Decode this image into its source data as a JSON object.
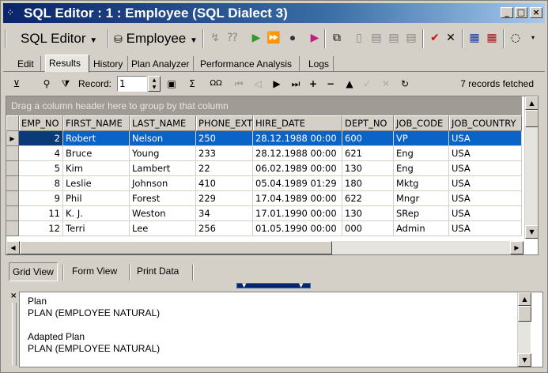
{
  "window": {
    "title": "SQL Editor : 1 : Employee (SQL Dialect 3)",
    "minimize": "_",
    "maximize": "□",
    "close": "×"
  },
  "toolbar": {
    "sql_editor_label": "SQL Editor",
    "database_label": "Employee"
  },
  "tabs": [
    "Edit",
    "Results",
    "History",
    "Plan Analyzer",
    "Performance Analysis",
    "Logs"
  ],
  "active_tab": "Results",
  "navigator": {
    "record_label": "Record:",
    "record_value": "1",
    "fetched_text": "7 records fetched"
  },
  "grid": {
    "group_hint": "Drag a column header here to group by that column",
    "columns": [
      "EMP_NO",
      "FIRST_NAME",
      "LAST_NAME",
      "PHONE_EXT",
      "HIRE_DATE",
      "DEPT_NO",
      "JOB_CODE",
      "JOB_COUNTRY"
    ],
    "rows": [
      [
        "2",
        "Robert",
        "Nelson",
        "250",
        "28.12.1988 00:00",
        "600",
        "VP",
        "USA"
      ],
      [
        "4",
        "Bruce",
        "Young",
        "233",
        "28.12.1988 00:00",
        "621",
        "Eng",
        "USA"
      ],
      [
        "5",
        "Kim",
        "Lambert",
        "22",
        "06.02.1989 00:00",
        "130",
        "Eng",
        "USA"
      ],
      [
        "8",
        "Leslie",
        "Johnson",
        "410",
        "05.04.1989 01:29",
        "180",
        "Mktg",
        "USA"
      ],
      [
        "9",
        "Phil",
        "Forest",
        "229",
        "17.04.1989 00:00",
        "622",
        "Mngr",
        "USA"
      ],
      [
        "11",
        "K. J.",
        "Weston",
        "34",
        "17.01.1990 00:00",
        "130",
        "SRep",
        "USA"
      ],
      [
        "12",
        "Terri",
        "Lee",
        "256",
        "01.05.1990 00:00",
        "000",
        "Admin",
        "USA"
      ]
    ],
    "selected_row": 0
  },
  "views": [
    "Grid View",
    "Form View",
    "Print Data"
  ],
  "active_view": "Grid View",
  "plan": {
    "lines": [
      "Plan",
      "PLAN (EMPLOYEE NATURAL)",
      "",
      "Adapted Plan",
      "PLAN (EMPLOYEE NATURAL)"
    ]
  },
  "colors": {
    "title_gradient_start": "#0a246a",
    "selection": "#0a64c8",
    "group_bar": "#a09c95"
  },
  "icons": [
    "database-icon",
    "run-icon",
    "commit-icon",
    "rollback-icon",
    "filter-icon",
    "sigma-icon",
    "omega-icon"
  ]
}
